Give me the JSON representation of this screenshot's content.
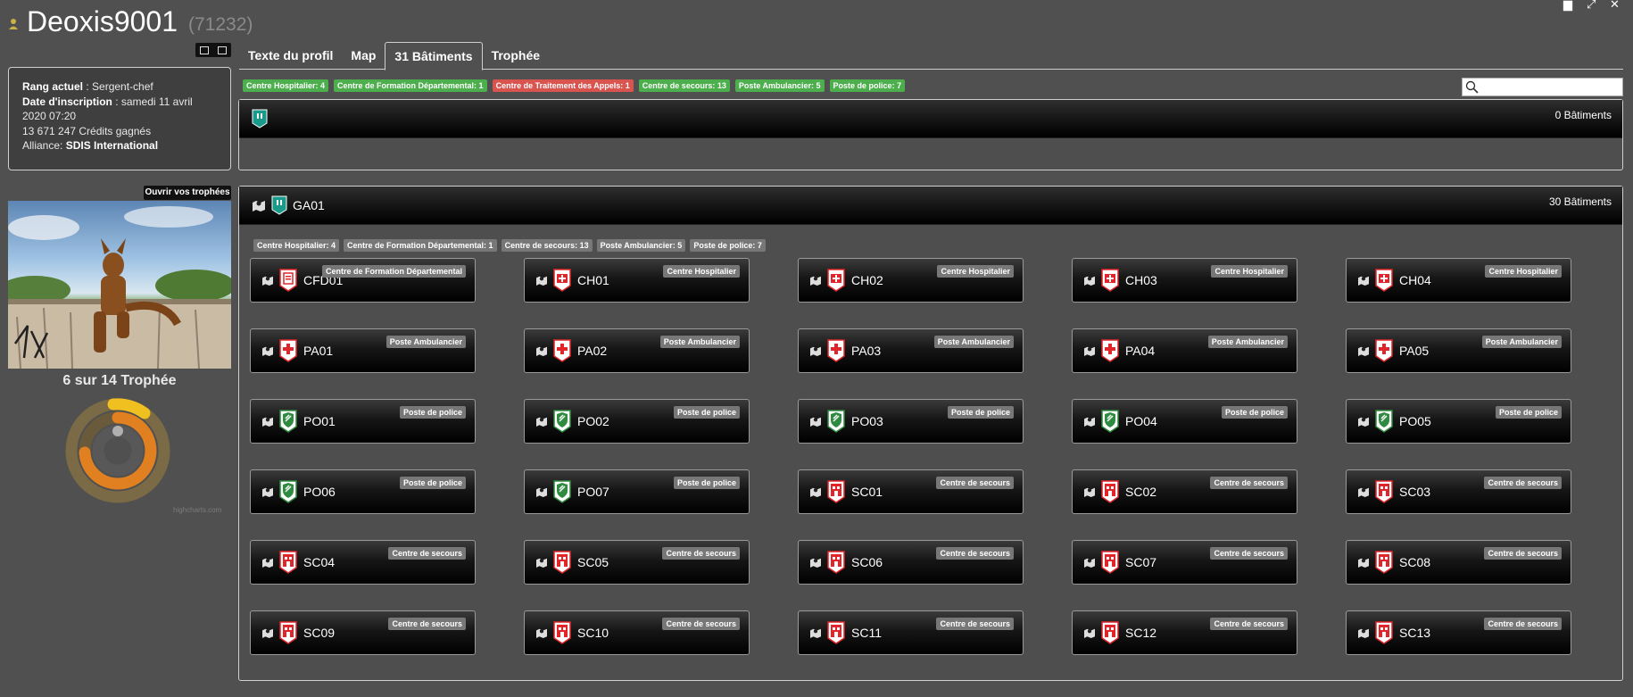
{
  "header": {
    "username": "Deoxis9001",
    "user_id": "(71232)"
  },
  "profile": {
    "rank_label": "Rang actuel",
    "rank_value": " : Sergent-chef",
    "inscription_label": "Date d'inscription",
    "inscription_value": " : samedi 11 avril 2020 07:20",
    "credits": "13 671 247 Crédits gagnés",
    "alliance_label": "Alliance:",
    "alliance_value": "SDIS International"
  },
  "trophies": {
    "open_button": "Ouvrir vos trophées",
    "count_label": "6 sur 14 Trophée",
    "credit": "highcharts.com"
  },
  "tabs": [
    "Texte du profil",
    "Map",
    "31 Bâtiments",
    "Trophée"
  ],
  "filters": [
    {
      "label": "Centre Hospitalier: 4",
      "color": "#4cae4c"
    },
    {
      "label": "Centre de Formation Départemental: 1",
      "color": "#4cae4c"
    },
    {
      "label": "Centre de Traitement des Appels: 1",
      "color": "#d9534f"
    },
    {
      "label": "Centre de secours: 13",
      "color": "#4cae4c"
    },
    {
      "label": "Poste Ambulancier: 5",
      "color": "#4cae4c"
    },
    {
      "label": "Poste de police: 7",
      "color": "#4cae4c"
    }
  ],
  "search": {
    "placeholder": ""
  },
  "panel1": {
    "count": "0 Bâtiments"
  },
  "panel2": {
    "name": "GA01",
    "count": "30 Bâtiments",
    "filters": [
      "Centre Hospitalier: 4",
      "Centre de Formation Départemental: 1",
      "Centre de secours: 13",
      "Poste Ambulancier: 5",
      "Poste de police: 7"
    ]
  },
  "colors": {
    "hospital": "#e0262a",
    "police_green": "#2e8b3f",
    "teal": "#1a9a8a"
  },
  "buildings": [
    {
      "name": "CFD01",
      "type": "Centre de Formation Départemental",
      "icon": "training-center-icon"
    },
    {
      "name": "CH01",
      "type": "Centre Hospitalier",
      "icon": "hospital-icon"
    },
    {
      "name": "CH02",
      "type": "Centre Hospitalier",
      "icon": "hospital-icon"
    },
    {
      "name": "CH03",
      "type": "Centre Hospitalier",
      "icon": "hospital-icon"
    },
    {
      "name": "CH04",
      "type": "Centre Hospitalier",
      "icon": "hospital-icon"
    },
    {
      "name": "PA01",
      "type": "Poste Ambulancier",
      "icon": "ambulance-cross-icon"
    },
    {
      "name": "PA02",
      "type": "Poste Ambulancier",
      "icon": "ambulance-cross-icon"
    },
    {
      "name": "PA03",
      "type": "Poste Ambulancier",
      "icon": "ambulance-cross-icon"
    },
    {
      "name": "PA04",
      "type": "Poste Ambulancier",
      "icon": "ambulance-cross-icon"
    },
    {
      "name": "PA05",
      "type": "Poste Ambulancier",
      "icon": "ambulance-cross-icon"
    },
    {
      "name": "PO01",
      "type": "Poste de police",
      "icon": "police-shield-icon"
    },
    {
      "name": "PO02",
      "type": "Poste de police",
      "icon": "police-shield-icon"
    },
    {
      "name": "PO03",
      "type": "Poste de police",
      "icon": "police-shield-icon"
    },
    {
      "name": "PO04",
      "type": "Poste de police",
      "icon": "police-shield-icon"
    },
    {
      "name": "PO05",
      "type": "Poste de police",
      "icon": "police-shield-icon"
    },
    {
      "name": "PO06",
      "type": "Poste de police",
      "icon": "police-shield-icon"
    },
    {
      "name": "PO07",
      "type": "Poste de police",
      "icon": "police-shield-icon"
    },
    {
      "name": "SC01",
      "type": "Centre de secours",
      "icon": "fire-station-icon"
    },
    {
      "name": "SC02",
      "type": "Centre de secours",
      "icon": "fire-station-icon"
    },
    {
      "name": "SC03",
      "type": "Centre de secours",
      "icon": "fire-station-icon"
    },
    {
      "name": "SC04",
      "type": "Centre de secours",
      "icon": "fire-station-icon"
    },
    {
      "name": "SC05",
      "type": "Centre de secours",
      "icon": "fire-station-icon"
    },
    {
      "name": "SC06",
      "type": "Centre de secours",
      "icon": "fire-station-icon"
    },
    {
      "name": "SC07",
      "type": "Centre de secours",
      "icon": "fire-station-icon"
    },
    {
      "name": "SC08",
      "type": "Centre de secours",
      "icon": "fire-station-icon"
    },
    {
      "name": "SC09",
      "type": "Centre de secours",
      "icon": "fire-station-icon"
    },
    {
      "name": "SC10",
      "type": "Centre de secours",
      "icon": "fire-station-icon"
    },
    {
      "name": "SC11",
      "type": "Centre de secours",
      "icon": "fire-station-icon"
    },
    {
      "name": "SC12",
      "type": "Centre de secours",
      "icon": "fire-station-icon"
    },
    {
      "name": "SC13",
      "type": "Centre de secours",
      "icon": "fire-station-icon"
    }
  ]
}
